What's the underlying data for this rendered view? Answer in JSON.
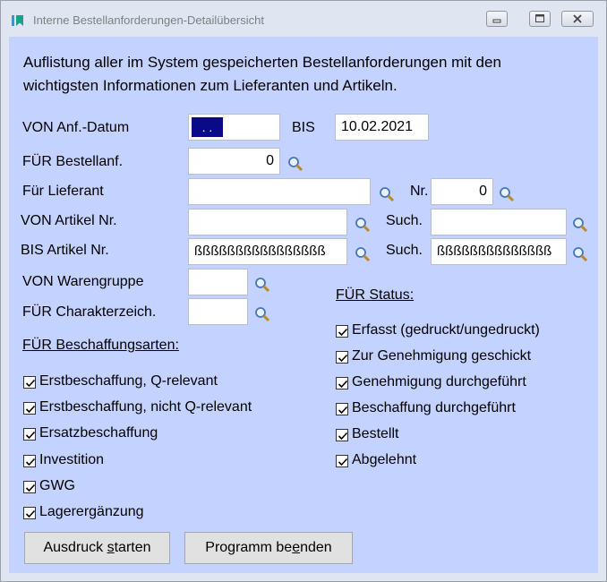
{
  "window": {
    "title": "Interne Bestellanforderungen-Detailübersicht",
    "accent_color": "#1ba089"
  },
  "intro": {
    "line1": "Auflistung aller im System gespeicherten Bestellanforderungen mit den",
    "line2": "wichtigsten Informationen zum Lieferanten und Artikeln."
  },
  "filters": {
    "von_datum_label": "VON Anf.-Datum",
    "von_datum_value": " .  .",
    "bis_label": "BIS",
    "bis_value": "10.02.2021",
    "bestellanf_label": "FÜR Bestellanf.",
    "bestellanf_value": "0",
    "lieferant_label": "Für Lieferant",
    "lieferant_value": "",
    "nr_label": "Nr.",
    "nr_value": "0",
    "von_artikel_label": "VON Artikel Nr.",
    "von_artikel_value": "",
    "such_label": "Such.",
    "von_such_value": "",
    "bis_artikel_label": "BIS Artikel Nr.",
    "bis_artikel_value": "ßßßßßßßßßßßßßßßß",
    "bis_such_value": "ßßßßßßßßßßßßßß",
    "warengruppe_label": "VON Warengruppe",
    "warengruppe_value": "",
    "charakter_label": "FÜR Charakterzeich.",
    "charakter_value": ""
  },
  "beschaffung": {
    "heading": "FÜR Beschaffungsarten:",
    "items": [
      {
        "label": "Erstbeschaffung, Q-relevant",
        "checked": true
      },
      {
        "label": "Erstbeschaffung, nicht Q-relevant",
        "checked": true
      },
      {
        "label": "Ersatzbeschaffung",
        "checked": true
      },
      {
        "label": "Investition",
        "checked": true
      },
      {
        "label": "GWG",
        "checked": true
      },
      {
        "label": "Lagerergänzung",
        "checked": true
      }
    ]
  },
  "status": {
    "heading": "FÜR Status:",
    "items": [
      {
        "label": "Erfasst (gedruckt/ungedruckt)",
        "checked": true
      },
      {
        "label": "Zur Genehmigung geschickt",
        "checked": true
      },
      {
        "label": "Genehmigung durchgeführt",
        "checked": true
      },
      {
        "label": "Beschaffung durchgeführt",
        "checked": true
      },
      {
        "label": "Bestellt",
        "checked": true
      },
      {
        "label": "Abgelehnt",
        "checked": true
      }
    ]
  },
  "buttons": {
    "print_pre": "Ausdruck ",
    "print_key": "s",
    "print_post": "tarten",
    "exit_pre": "Programm be",
    "exit_key": "e",
    "exit_post": "nden"
  },
  "colors": {
    "panel_bg": "#c3d2ff",
    "selection_bg": "#0a0a88"
  }
}
